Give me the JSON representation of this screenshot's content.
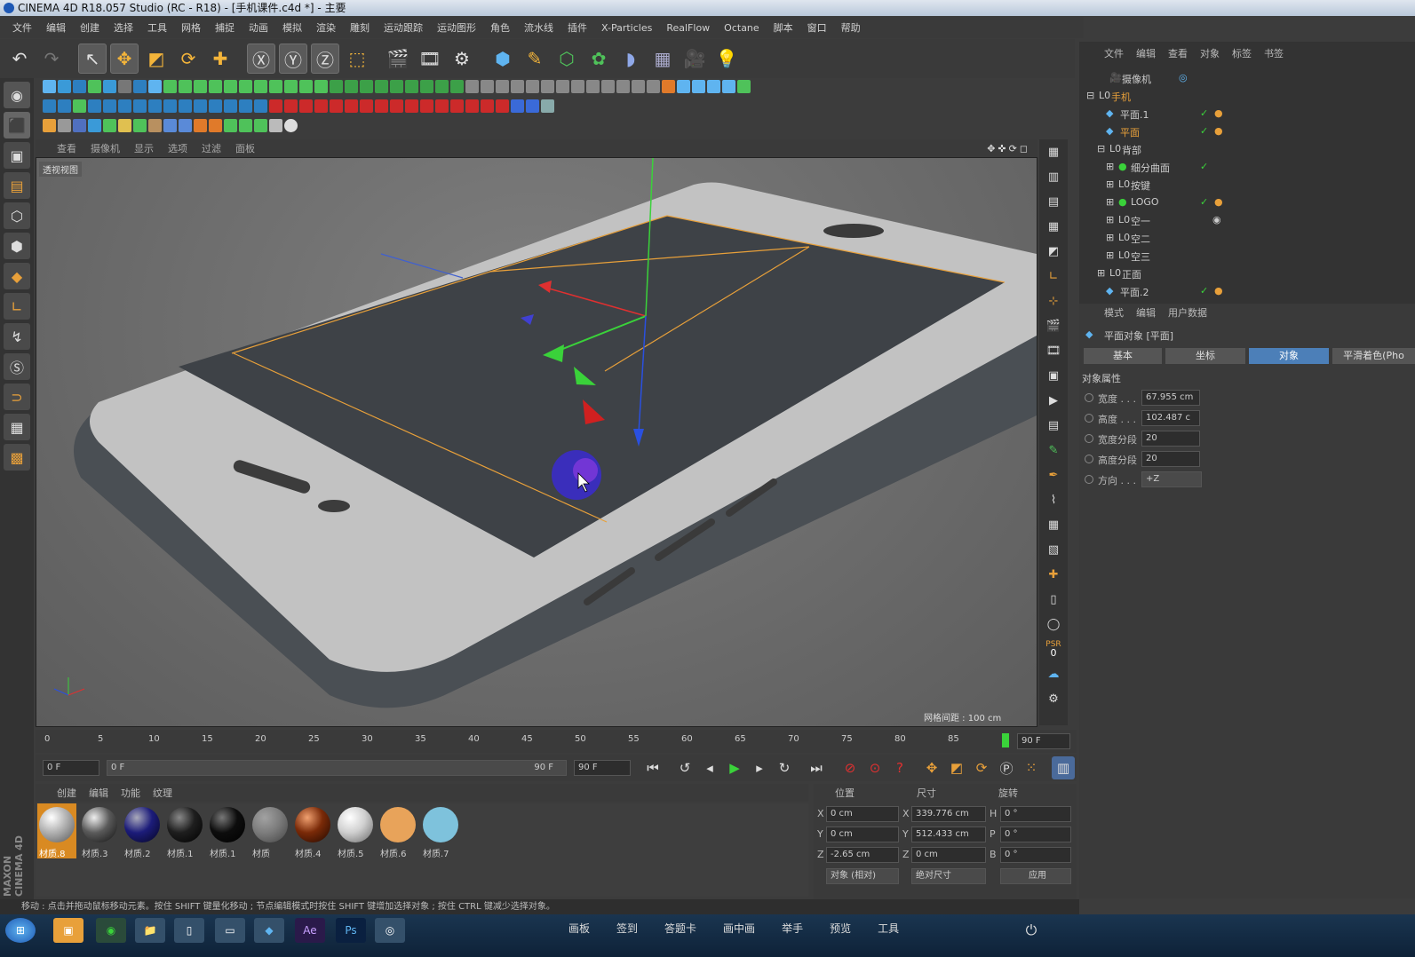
{
  "window": {
    "title": "CINEMA 4D R18.057 Studio (RC - R18) - [手机课件.c4d *] - 主要"
  },
  "menubar": [
    "文件",
    "编辑",
    "创建",
    "选择",
    "工具",
    "网格",
    "捕捉",
    "动画",
    "模拟",
    "渲染",
    "雕刻",
    "运动跟踪",
    "运动图形",
    "角色",
    "流水线",
    "插件",
    "X-Particles",
    "RealFlow",
    "Octane",
    "脚本",
    "窗口",
    "帮助"
  ],
  "viewport": {
    "menu": [
      "查看",
      "摄像机",
      "显示",
      "选项",
      "过滤",
      "面板"
    ],
    "label": "透视视图",
    "grid_info": "网格间距 : 100 cm"
  },
  "timeline": {
    "ticks": [
      "0",
      "5",
      "10",
      "15",
      "20",
      "25",
      "30",
      "35",
      "40",
      "45",
      "50",
      "55",
      "60",
      "65",
      "70",
      "75",
      "80",
      "85"
    ],
    "end_frame": "90 F",
    "start_field": "0 F",
    "range_start": "0 F",
    "range_end": "90 F",
    "max_field": "90 F"
  },
  "materials": {
    "menu": [
      "创建",
      "编辑",
      "功能",
      "纹理"
    ],
    "items": [
      {
        "name": "材质.8",
        "color": "#b9b9b9"
      },
      {
        "name": "材质.3",
        "color": "#5a5a5a"
      },
      {
        "name": "材质.2",
        "color": "#1c1c7a"
      },
      {
        "name": "材质.1",
        "color": "#1e1e1e"
      },
      {
        "name": "材质.1",
        "color": "#0d0d0d"
      },
      {
        "name": "材质",
        "color": "#8c8c8c"
      },
      {
        "name": "材质.4",
        "color": "#7a2a08"
      },
      {
        "name": "材质.5",
        "color": "#cfcfcf"
      },
      {
        "name": "材质.6",
        "color": "#e8a35a"
      },
      {
        "name": "材质.7",
        "color": "#7ec2dc"
      }
    ]
  },
  "coords": {
    "headers": [
      "位置",
      "尺寸",
      "旋转"
    ],
    "rows": [
      {
        "axis": "X",
        "pos": "0 cm",
        "size_axis": "X",
        "size": "339.776 cm",
        "rot_axis": "H",
        "rot": "0 °"
      },
      {
        "axis": "Y",
        "pos": "0 cm",
        "size_axis": "Y",
        "size": "512.433 cm",
        "rot_axis": "P",
        "rot": "0 °"
      },
      {
        "axis": "Z",
        "pos": "-2.65 cm",
        "size_axis": "Z",
        "size": "0 cm",
        "rot_axis": "B",
        "rot": "0 °"
      }
    ],
    "mode": "对象 (相对)",
    "size_mode": "绝对尺寸",
    "apply": "应用"
  },
  "status": "移动 : 点击并拖动鼠标移动元素。按住 SHIFT 键量化移动 ; 节点编辑模式时按住 SHIFT 键增加选择对象 ; 按住 CTRL 键减少选择对象。",
  "maxon": "MAXON CINEMA 4D",
  "object_manager": {
    "menu": [
      "文件",
      "编辑",
      "查看",
      "对象",
      "标签",
      "书签"
    ],
    "rows": [
      {
        "name": "摄像机",
        "indent": 1,
        "selected": false
      },
      {
        "name": "手机",
        "indent": 0,
        "selected": true
      },
      {
        "name": "平面.1",
        "indent": 1,
        "selected": false
      },
      {
        "name": "平面",
        "indent": 1,
        "selected": true
      },
      {
        "name": "背部",
        "indent": 1,
        "selected": false
      },
      {
        "name": "细分曲面",
        "indent": 2,
        "selected": false
      },
      {
        "name": "按键",
        "indent": 2,
        "selected": false
      },
      {
        "name": "LOGO",
        "indent": 2,
        "selected": false
      },
      {
        "name": "空一",
        "indent": 2,
        "selected": false
      },
      {
        "name": "空二",
        "indent": 2,
        "selected": false
      },
      {
        "name": "空三",
        "indent": 2,
        "selected": false
      },
      {
        "name": "正面",
        "indent": 1,
        "selected": false
      },
      {
        "name": "平面.2",
        "indent": 1,
        "selected": false
      }
    ]
  },
  "attributes": {
    "menu": [
      "模式",
      "编辑",
      "用户数据"
    ],
    "object_title": "平面对象 [平面]",
    "tabs": [
      "基本",
      "坐标",
      "对象",
      "平滑着色(Pho"
    ],
    "active_tab": "对象",
    "section": "对象属性",
    "props": [
      {
        "label": "宽度 . . .",
        "value": "67.955 cm"
      },
      {
        "label": "高度 . . .",
        "value": "102.487 c"
      },
      {
        "label": "宽度分段",
        "value": "20"
      },
      {
        "label": "高度分段",
        "value": "20"
      },
      {
        "label": "方向 . . .",
        "value": "+Z"
      }
    ]
  },
  "taskbar": {
    "center": [
      "画板",
      "签到",
      "答题卡",
      "画中画",
      "举手",
      "预览",
      "工具"
    ],
    "apps": [
      "Ae",
      "Ps"
    ]
  },
  "psr": {
    "label": "PSR",
    "value": "0"
  }
}
